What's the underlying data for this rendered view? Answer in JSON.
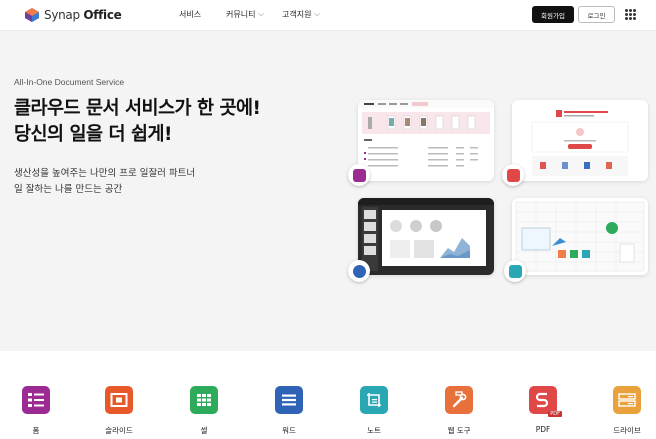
{
  "header": {
    "logo_text_a": "Synap",
    "logo_text_b": "Office",
    "nav": [
      {
        "label": "서비스",
        "dropdown": false
      },
      {
        "label": "커뮤니티",
        "dropdown": true
      },
      {
        "label": "고객지원",
        "dropdown": true
      }
    ],
    "signup_label": "회원가입",
    "login_label": "로그인"
  },
  "hero": {
    "eyebrow": "All-In-One Document Service",
    "headline_line1": "클라우드 문서 서비스가 한 곳에!",
    "headline_line2": "당신의 일을 더 쉽게!",
    "sub_line1": "생산성을 높여주는 나만의 프로 일잘러 파트너",
    "sub_line2": "일 잘하는 나를 만드는 공간"
  },
  "apps": [
    {
      "label": "폼",
      "color": "#9c2a93",
      "icon": "form-icon"
    },
    {
      "label": "슬라이드",
      "color": "#e7582b",
      "icon": "slide-icon"
    },
    {
      "label": "셀",
      "color": "#2eaa5c",
      "icon": "cell-icon"
    },
    {
      "label": "워드",
      "color": "#2f63b5",
      "icon": "word-icon"
    },
    {
      "label": "노트",
      "color": "#29a7b5",
      "icon": "note-icon"
    },
    {
      "label": "웹 도구",
      "color": "#e8703a",
      "icon": "webtool-icon"
    },
    {
      "label": "PDF",
      "color": "#e04848",
      "icon": "pdf-icon"
    },
    {
      "label": "드라이브",
      "color": "#e9a23b",
      "icon": "drive-icon"
    }
  ],
  "colors": {
    "hero_bg": "#f4f4f4",
    "primary_dark": "#111111"
  }
}
